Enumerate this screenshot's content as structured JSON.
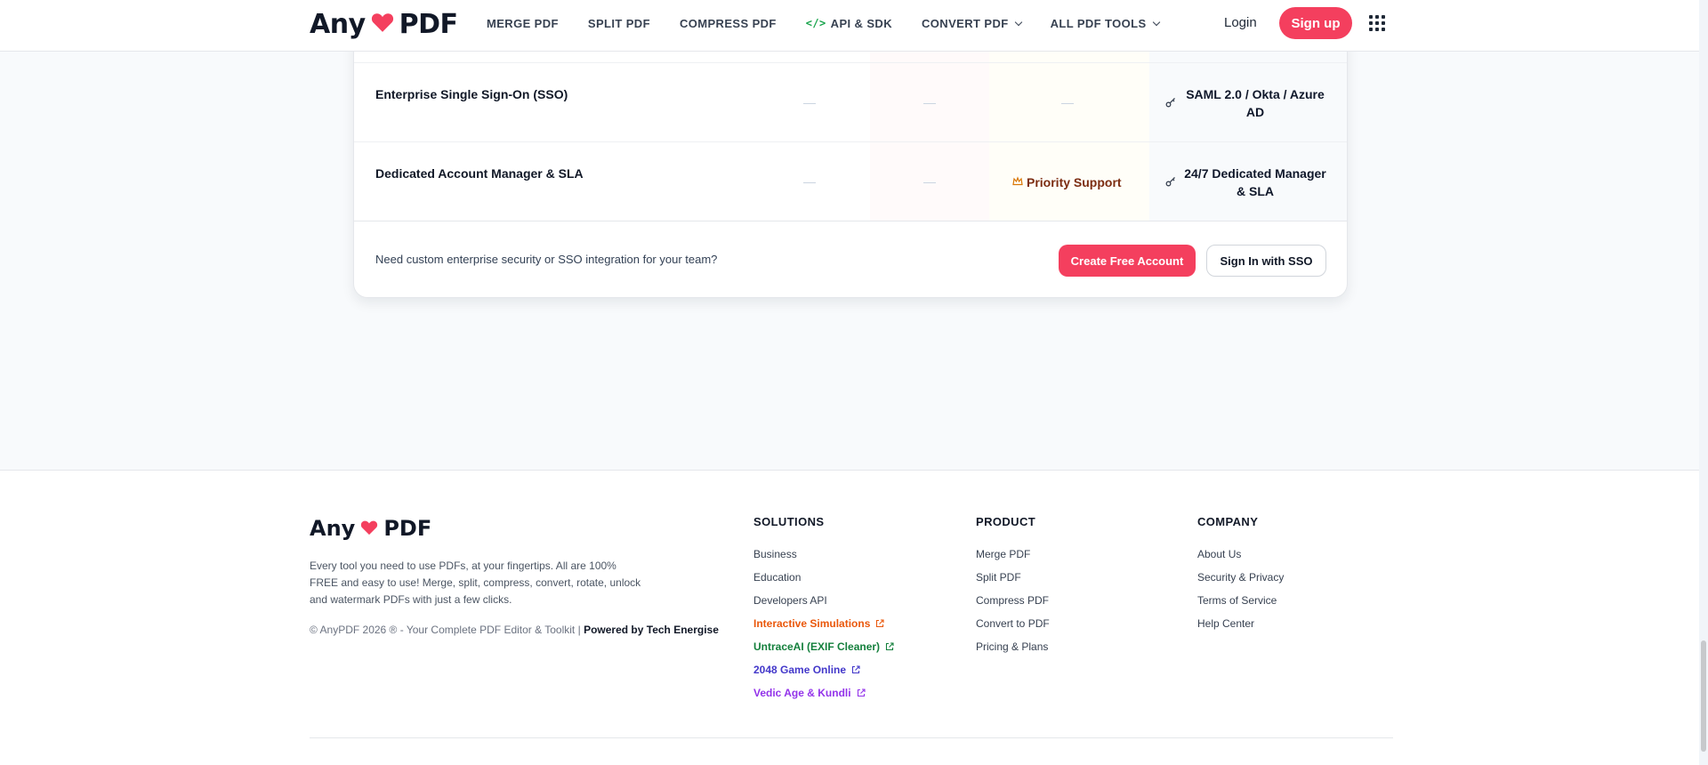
{
  "colors": {
    "brand": "#f43f5e",
    "heart": "#f43f5e"
  },
  "header": {
    "logo": {
      "left": "Any",
      "right": "PDF"
    },
    "nav": [
      {
        "label": "MERGE PDF",
        "icon": "",
        "dropdown": false
      },
      {
        "label": "SPLIT PDF",
        "icon": "",
        "dropdown": false
      },
      {
        "label": "COMPRESS PDF",
        "icon": "",
        "dropdown": false
      },
      {
        "label": "API & SDK",
        "icon": "code-icon",
        "dropdown": false
      },
      {
        "label": "CONVERT PDF",
        "icon": "",
        "dropdown": true
      },
      {
        "label": "ALL PDF TOOLS",
        "icon": "",
        "dropdown": true
      }
    ],
    "login": "Login",
    "signup": "Sign up"
  },
  "pricing": {
    "rows": [
      {
        "feature": "Enterprise Single Sign-On (SSO)",
        "enterprise": "SAML 2.0 / Okta / Azure AD"
      },
      {
        "feature": "Dedicated Account Manager & SLA",
        "team": "Priority Support",
        "enterprise": "24/7 Dedicated Manager & SLA"
      }
    ],
    "cta_question": "Need custom enterprise security or SSO integration for your team?",
    "primary_button": "Create Free Account",
    "secondary_button": "Sign In with SSO"
  },
  "footer": {
    "logo": {
      "left": "Any",
      "right": "PDF"
    },
    "description": "Every tool you need to use PDFs, at your fingertips. All are 100% FREE and easy to use! Merge, split, compress, convert, rotate, unlock and watermark PDFs with just a few clicks.",
    "copyright": "© AnyPDF 2026 ® - Your Complete PDF Editor & Toolkit |",
    "powered_by": "Powered by Tech Energise",
    "solutions": {
      "title": "SOLUTIONS",
      "links": [
        {
          "label": "Business"
        },
        {
          "label": "Education"
        },
        {
          "label": "Developers API"
        },
        {
          "label": "Interactive Simulations",
          "color": "#ea580c",
          "external": true
        },
        {
          "label": "UntraceAI (EXIF Cleaner)",
          "color": "#15803d",
          "external": true
        },
        {
          "label": "2048 Game Online",
          "color": "#4338ca",
          "external": true
        },
        {
          "label": "Vedic Age & Kundli",
          "color": "#9333ea",
          "external": true
        }
      ]
    },
    "product": {
      "title": "PRODUCT",
      "links": [
        {
          "label": "Merge PDF"
        },
        {
          "label": "Split PDF"
        },
        {
          "label": "Compress PDF"
        },
        {
          "label": "Convert to PDF"
        },
        {
          "label": "Pricing & Plans"
        }
      ]
    },
    "company": {
      "title": "COMPANY",
      "links": [
        {
          "label": "About Us"
        },
        {
          "label": "Security & Privacy"
        },
        {
          "label": "Terms of Service"
        },
        {
          "label": "Help Center"
        }
      ]
    }
  }
}
